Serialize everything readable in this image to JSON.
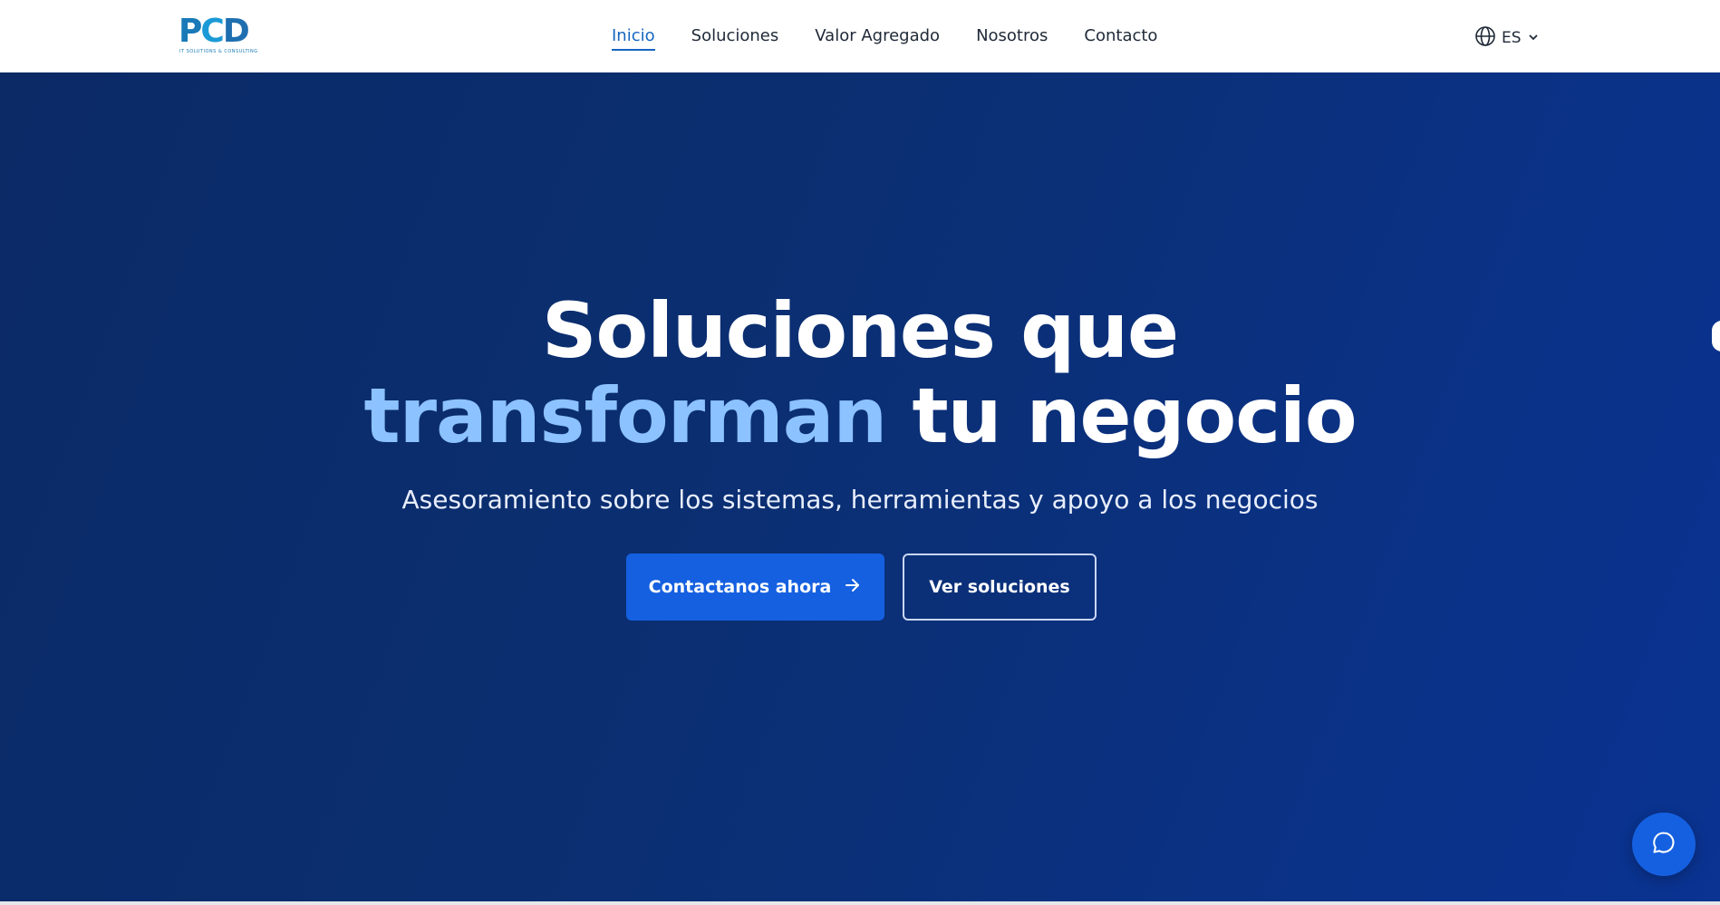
{
  "brand": {
    "logo_letters": [
      "P",
      "C",
      "D"
    ],
    "tagline": "IT SOLUTIONS & CONSULTING"
  },
  "nav": {
    "items": [
      {
        "label": "Inicio",
        "active": true
      },
      {
        "label": "Soluciones",
        "active": false
      },
      {
        "label": "Valor Agregado",
        "active": false
      },
      {
        "label": "Nosotros",
        "active": false
      },
      {
        "label": "Contacto",
        "active": false
      }
    ],
    "language": {
      "label": "ES",
      "icon": "globe-icon",
      "caret_icon": "chevron-down-icon"
    }
  },
  "hero": {
    "title_line1": "Soluciones que",
    "title_accent": "transforman",
    "title_rest": "tu negocio",
    "subtitle": "Asesoramiento sobre los sistemas, herramientas y apoyo a los negocios",
    "primary_cta": {
      "label": "Contactanos ahora",
      "icon": "arrow-right-icon"
    },
    "secondary_cta": {
      "label": "Ver soluciones"
    }
  },
  "chat": {
    "icon": "chat-bubble-icon"
  },
  "colors": {
    "brand_blue": "#1560e0",
    "hero_dark": "#0b2a66",
    "accent_light_blue": "#8cc2ff",
    "nav_active": "#1565c0"
  }
}
